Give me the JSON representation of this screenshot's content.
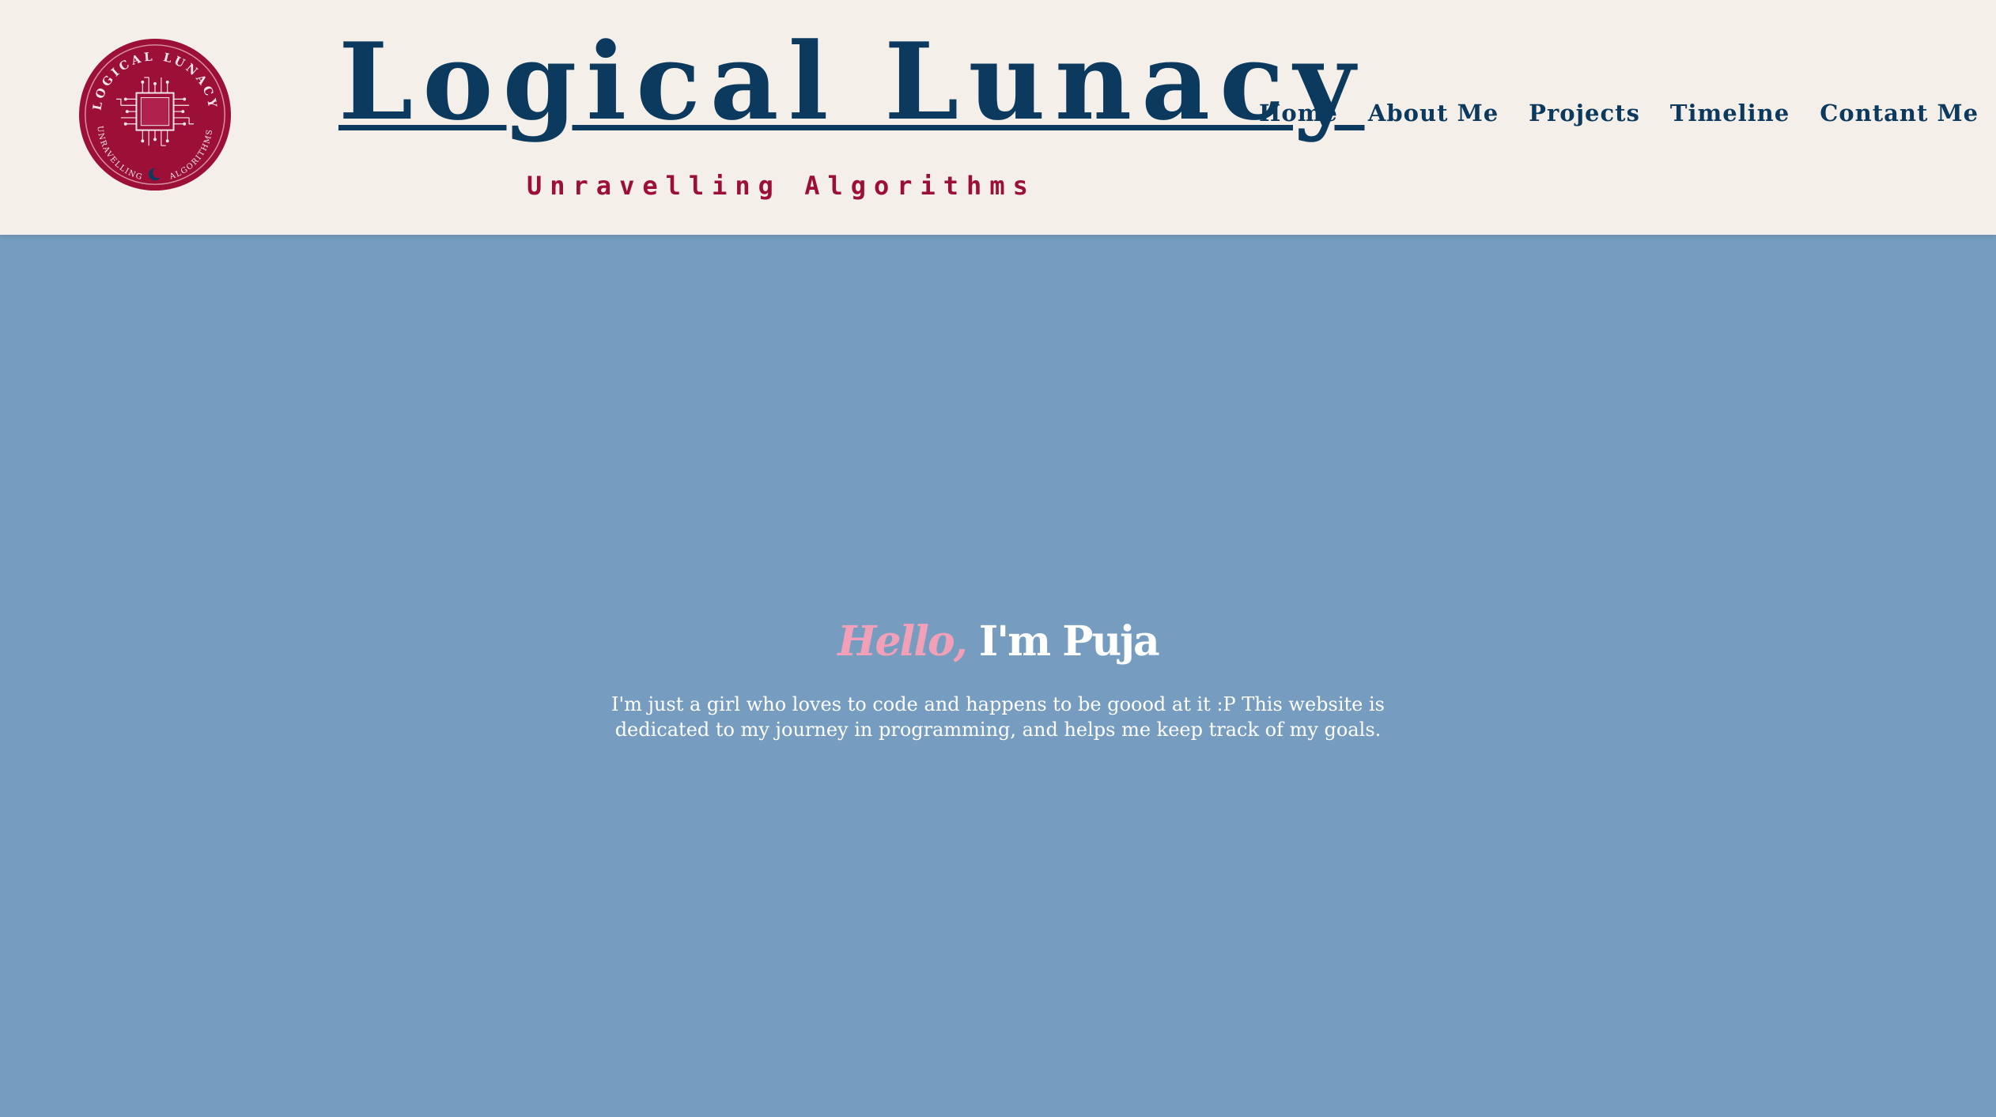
{
  "header": {
    "logo": {
      "ring_top_text": "LOGICAL LUNACY",
      "ring_bottom_left": "UNRAVELLING",
      "ring_bottom_right": "ALGORITHMS",
      "icon": "circuit-chip-icon",
      "color": "#9c1038"
    },
    "title": "Logical Lunacy",
    "tagline": "Unravelling Algorithms"
  },
  "nav": {
    "items": [
      {
        "label": "Home"
      },
      {
        "label": "About Me"
      },
      {
        "label": "Projects"
      },
      {
        "label": "Timeline"
      },
      {
        "label": "Contant Me"
      }
    ]
  },
  "hero": {
    "greeting": "Hello,",
    "name": "I'm Puja",
    "description": "I'm just a girl who loves to code and happens to be goood at it :P This website is dedicated to my journey in programming, and helps me keep track of my goals."
  },
  "colors": {
    "header_bg": "#f4efe9",
    "main_bg": "#769dc0",
    "navy": "#0b3a5e",
    "crimson": "#9c1038",
    "pink": "#f2a0b8"
  }
}
